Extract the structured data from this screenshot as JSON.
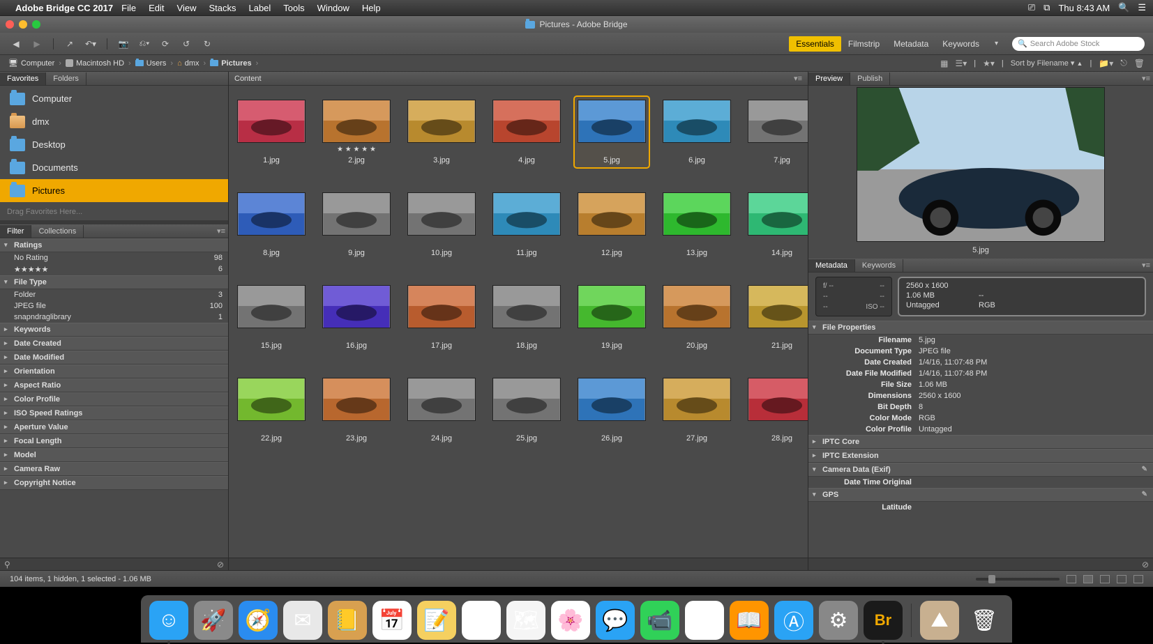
{
  "menubar": {
    "app_name": "Adobe Bridge CC 2017",
    "items": [
      "File",
      "Edit",
      "View",
      "Stacks",
      "Label",
      "Tools",
      "Window",
      "Help"
    ],
    "clock": "Thu 8:43 AM"
  },
  "window": {
    "title": "Pictures - Adobe Bridge",
    "workspaces": [
      "Essentials",
      "Filmstrip",
      "Metadata",
      "Keywords"
    ],
    "active_workspace": 0,
    "search_placeholder": "Search Adobe Stock"
  },
  "path": [
    {
      "icon": "computer",
      "label": "Computer"
    },
    {
      "icon": "drive",
      "label": "Macintosh HD"
    },
    {
      "icon": "folder",
      "label": "Users"
    },
    {
      "icon": "home",
      "label": "dmx"
    },
    {
      "icon": "folder",
      "label": "Pictures",
      "bold": true
    }
  ],
  "sort_label": "Sort by Filename",
  "left": {
    "tabs_top": [
      "Favorites",
      "Folders"
    ],
    "active_top": 0,
    "favorites": [
      {
        "name": "Computer",
        "icon": "computer"
      },
      {
        "name": "dmx",
        "icon": "home"
      },
      {
        "name": "Desktop",
        "icon": "folder"
      },
      {
        "name": "Documents",
        "icon": "folder"
      },
      {
        "name": "Pictures",
        "icon": "folder",
        "selected": true
      }
    ],
    "fav_hint": "Drag Favorites Here...",
    "tabs_bottom": [
      "Filter",
      "Collections"
    ],
    "active_bottom": 0,
    "filter": {
      "sections": [
        {
          "name": "Ratings",
          "open": true,
          "rows": [
            {
              "label": "No Rating",
              "count": 98
            },
            {
              "label": "★★★★★",
              "count": 6
            }
          ]
        },
        {
          "name": "File Type",
          "open": true,
          "rows": [
            {
              "label": "Folder",
              "count": 3
            },
            {
              "label": "JPEG file",
              "count": 100
            },
            {
              "label": "snapndraglibrary",
              "count": 1
            }
          ]
        },
        {
          "name": "Keywords"
        },
        {
          "name": "Date Created"
        },
        {
          "name": "Date Modified"
        },
        {
          "name": "Orientation"
        },
        {
          "name": "Aspect Ratio"
        },
        {
          "name": "Color Profile"
        },
        {
          "name": "ISO Speed Ratings"
        },
        {
          "name": "Aperture Value"
        },
        {
          "name": "Focal Length"
        },
        {
          "name": "Model"
        },
        {
          "name": "Camera Raw"
        },
        {
          "name": "Copyright Notice"
        }
      ]
    }
  },
  "content": {
    "header": "Content",
    "files": [
      {
        "name": "1.jpg",
        "hue": 350
      },
      {
        "name": "2.jpg",
        "hue": 30,
        "rating": "★ ★ ★ ★ ★"
      },
      {
        "name": "3.jpg",
        "hue": 40
      },
      {
        "name": "4.jpg",
        "hue": 10
      },
      {
        "name": "5.jpg",
        "hue": 210,
        "selected": true
      },
      {
        "name": "6.jpg",
        "hue": 200
      },
      {
        "name": "7.jpg",
        "hue": 0,
        "sat": 0
      },
      {
        "name": "8.jpg",
        "hue": 220
      },
      {
        "name": "9.jpg",
        "hue": 0,
        "sat": 0
      },
      {
        "name": "10.jpg",
        "hue": 0,
        "sat": 0
      },
      {
        "name": "11.jpg",
        "hue": 200
      },
      {
        "name": "12.jpg",
        "hue": 35
      },
      {
        "name": "13.jpg",
        "hue": 120
      },
      {
        "name": "14.jpg",
        "hue": 150
      },
      {
        "name": "15.jpg",
        "hue": 0,
        "sat": 0
      },
      {
        "name": "16.jpg",
        "hue": 250
      },
      {
        "name": "17.jpg",
        "hue": 20
      },
      {
        "name": "18.jpg",
        "hue": 0,
        "sat": 0
      },
      {
        "name": "19.jpg",
        "hue": 110
      },
      {
        "name": "20.jpg",
        "hue": 30
      },
      {
        "name": "21.jpg",
        "hue": 45
      },
      {
        "name": "22.jpg",
        "hue": 90
      },
      {
        "name": "23.jpg",
        "hue": 25
      },
      {
        "name": "24.jpg",
        "hue": 0,
        "sat": 0
      },
      {
        "name": "25.jpg",
        "hue": 0,
        "sat": 0
      },
      {
        "name": "26.jpg",
        "hue": 210
      },
      {
        "name": "27.jpg",
        "hue": 40
      },
      {
        "name": "28.jpg",
        "hue": 355
      }
    ]
  },
  "preview": {
    "tabs": [
      "Preview",
      "Publish"
    ],
    "active": 0,
    "filename": "5.jpg"
  },
  "metadata": {
    "tabs": [
      "Metadata",
      "Keywords"
    ],
    "active": 0,
    "summary_left": {
      "aperture": "f/ --",
      "shutter": "--",
      "awb": "--",
      "ev": "--",
      "iso_label": "ISO",
      "iso": "--",
      "flash": "--"
    },
    "summary_right": {
      "dimensions": "2560 x 1600",
      "filesize": "1.06 MB",
      "dpi": "--",
      "profile": "Untagged",
      "mode": "RGB"
    },
    "file_properties": [
      {
        "k": "Filename",
        "v": "5.jpg"
      },
      {
        "k": "Document Type",
        "v": "JPEG file"
      },
      {
        "k": "Date Created",
        "v": "1/4/16, 11:07:48 PM"
      },
      {
        "k": "Date File Modified",
        "v": "1/4/16, 11:07:48 PM"
      },
      {
        "k": "File Size",
        "v": "1.06 MB"
      },
      {
        "k": "Dimensions",
        "v": "2560 x 1600"
      },
      {
        "k": "Bit Depth",
        "v": "8"
      },
      {
        "k": "Color Mode",
        "v": "RGB"
      },
      {
        "k": "Color Profile",
        "v": "Untagged"
      }
    ],
    "sections": [
      {
        "name": "IPTC Core",
        "closed": true
      },
      {
        "name": "IPTC Extension",
        "closed": true
      },
      {
        "name": "Camera Data (Exif)",
        "rows": [
          {
            "k": "Date Time Original",
            "v": ""
          }
        ],
        "pencil": true
      },
      {
        "name": "GPS",
        "rows": [
          {
            "k": "Latitude",
            "v": ""
          }
        ],
        "pencil": true
      }
    ]
  },
  "status": "104 items, 1 hidden, 1 selected - 1.06 MB",
  "dock": [
    {
      "name": "finder",
      "bg": "#2aa3f5",
      "glyph": "☺",
      "running": true
    },
    {
      "name": "launchpad",
      "bg": "#8a8a8a",
      "glyph": "🚀"
    },
    {
      "name": "safari",
      "bg": "#2a8cf0",
      "glyph": "🧭"
    },
    {
      "name": "mail",
      "bg": "#e8e8e8",
      "glyph": "✉"
    },
    {
      "name": "contacts",
      "bg": "#d8a050",
      "glyph": "📒"
    },
    {
      "name": "calendar",
      "bg": "#ffffff",
      "glyph": "📅"
    },
    {
      "name": "notes",
      "bg": "#f5d060",
      "glyph": "📝"
    },
    {
      "name": "reminders",
      "bg": "#ffffff",
      "glyph": "☑"
    },
    {
      "name": "maps",
      "bg": "#f5f5f5",
      "glyph": "🗺"
    },
    {
      "name": "photos",
      "bg": "#ffffff",
      "glyph": "🌸"
    },
    {
      "name": "messages",
      "bg": "#2aa3f5",
      "glyph": "💬"
    },
    {
      "name": "facetime",
      "bg": "#30d158",
      "glyph": "📹"
    },
    {
      "name": "itunes",
      "bg": "#ffffff",
      "glyph": "♪"
    },
    {
      "name": "ibooks",
      "bg": "#ff9500",
      "glyph": "📖"
    },
    {
      "name": "appstore",
      "bg": "#2aa3f5",
      "glyph": "Ⓐ"
    },
    {
      "name": "preferences",
      "bg": "#888",
      "glyph": "⚙"
    },
    {
      "name": "bridge",
      "bg": "#1a1a1a",
      "glyph": "Br",
      "running": true,
      "text_color": "#f0a800"
    }
  ],
  "dock_right": [
    {
      "name": "downloads",
      "bg": "#c8b090",
      "glyph": "⛰"
    },
    {
      "name": "trash",
      "bg": "transparent",
      "glyph": "🗑"
    }
  ]
}
